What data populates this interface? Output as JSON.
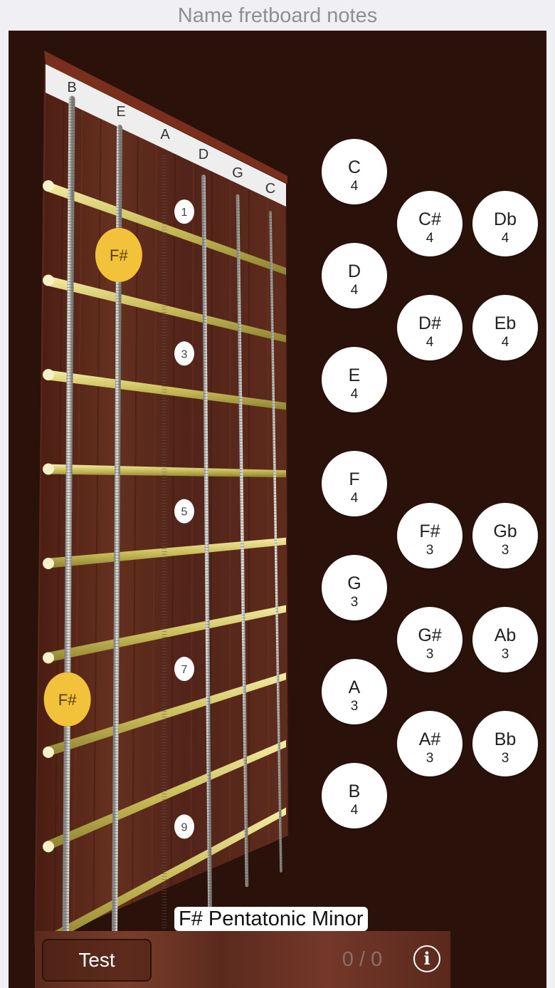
{
  "header": {
    "title": "Name fretboard notes"
  },
  "fretboard": {
    "strings": [
      "B",
      "E",
      "A",
      "D",
      "G",
      "C"
    ],
    "fret_markers": [
      "1",
      "3",
      "5",
      "7",
      "9"
    ],
    "highlighted_notes": [
      {
        "label": "F#",
        "string": "E",
        "fret": 2
      },
      {
        "label": "F#",
        "string": "B",
        "fret": 7
      }
    ],
    "colors": {
      "wood": "#5a2618",
      "fret_wire": "#d8cf73",
      "nut": "#eeeeee",
      "highlight": "#f2c23a",
      "background": "#2a120a"
    }
  },
  "note_buttons": [
    {
      "note": "C",
      "octave": "4"
    },
    {
      "note": "C#",
      "octave": "4"
    },
    {
      "note": "Db",
      "octave": "4"
    },
    {
      "note": "D",
      "octave": "4"
    },
    {
      "note": "D#",
      "octave": "4"
    },
    {
      "note": "Eb",
      "octave": "4"
    },
    {
      "note": "E",
      "octave": "4"
    },
    {
      "note": "F",
      "octave": "4"
    },
    {
      "note": "F#",
      "octave": "3"
    },
    {
      "note": "Gb",
      "octave": "3"
    },
    {
      "note": "G",
      "octave": "3"
    },
    {
      "note": "G#",
      "octave": "3"
    },
    {
      "note": "Ab",
      "octave": "3"
    },
    {
      "note": "A",
      "octave": "3"
    },
    {
      "note": "A#",
      "octave": "3"
    },
    {
      "note": "Bb",
      "octave": "3"
    },
    {
      "note": "B",
      "octave": "4"
    }
  ],
  "scale_label": "F# Pentatonic Minor",
  "footer": {
    "test_label": "Test",
    "score": "0 / 0",
    "info_icon": "info-icon"
  }
}
